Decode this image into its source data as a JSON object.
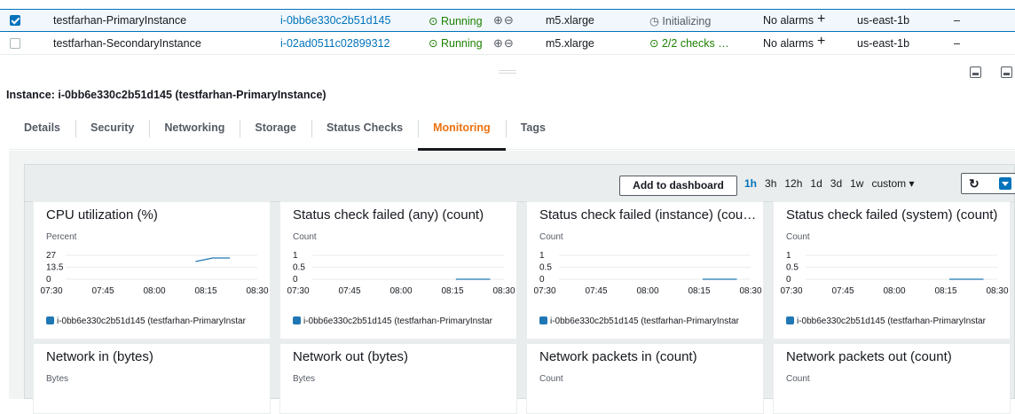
{
  "instances": [
    {
      "selected": true,
      "name": "testfarhan-PrimaryInstance",
      "id": "i-0bb6e330c2b51d145",
      "state": "Running",
      "type": "m5.xlarge",
      "status_check": "Initializing",
      "alarms": "No alarms",
      "az": "us-east-1b",
      "ip": "–"
    },
    {
      "selected": false,
      "name": "testfarhan-SecondaryInstance",
      "id": "i-02ad0511c02899312",
      "state": "Running",
      "type": "m5.xlarge",
      "status_check": "2/2 checks …",
      "alarms": "No alarms",
      "az": "us-east-1b",
      "ip": "–"
    }
  ],
  "details_header": "Instance: i-0bb6e330c2b51d145 (testfarhan-PrimaryInstance)",
  "tabs": [
    "Details",
    "Security",
    "Networking",
    "Storage",
    "Status Checks",
    "Monitoring",
    "Tags"
  ],
  "active_tab": "Monitoring",
  "toolbar": {
    "add_dashboard": "Add to dashboard",
    "ranges": [
      "1h",
      "3h",
      "12h",
      "1d",
      "3d",
      "1w",
      "custom ▾"
    ],
    "active_range": "1h"
  },
  "icons": {
    "running": "check-circle-icon",
    "initializing": "clock-icon",
    "zoom": "zoom-icons",
    "refresh": "refresh-icon",
    "dropdown": "caret-down-icon",
    "add_alarm": "plus-icon"
  },
  "colors": {
    "accent": "#0073bb",
    "active_tab": "#ec7211",
    "ok": "#1d8102",
    "series": "#1f77b4"
  },
  "legend_label": "i-0bb6e330c2b51d145 (testfarhan-PrimaryInstar",
  "chart_data": [
    {
      "type": "line",
      "title": "CPU utilization (%)",
      "ylabel": "Percent",
      "yticks": [
        "27",
        "13.5",
        "0"
      ],
      "ylim": [
        0,
        27
      ],
      "xticks": [
        "07:30",
        "07:45",
        "08:00",
        "08:15",
        "08:30"
      ],
      "series": [
        {
          "name": "i-0bb6e330c2b51d145 (testfarhan-PrimaryInstar",
          "x": [
            "08:12",
            "08:17",
            "08:22"
          ],
          "values": [
            20,
            24,
            24
          ]
        }
      ]
    },
    {
      "type": "line",
      "title": "Status check failed (any) (count)",
      "ylabel": "Count",
      "yticks": [
        "1",
        "0.5",
        "0"
      ],
      "ylim": [
        0,
        1
      ],
      "xticks": [
        "07:30",
        "07:45",
        "08:00",
        "08:15",
        "08:30"
      ],
      "series": [
        {
          "name": "i-0bb6e330c2b51d145 (testfarhan-PrimaryInstar",
          "x": [
            "08:16",
            "08:26"
          ],
          "values": [
            0,
            0
          ]
        }
      ]
    },
    {
      "type": "line",
      "title": "Status check failed (instance) (cou…",
      "ylabel": "Count",
      "yticks": [
        "1",
        "0.5",
        "0"
      ],
      "ylim": [
        0,
        1
      ],
      "xticks": [
        "07:30",
        "07:45",
        "08:00",
        "08:15",
        "08:30"
      ],
      "series": [
        {
          "name": "i-0bb6e330c2b51d145 (testfarhan-PrimaryInstar",
          "x": [
            "08:16",
            "08:26"
          ],
          "values": [
            0,
            0
          ]
        }
      ]
    },
    {
      "type": "line",
      "title": "Status check failed (system) (count)",
      "ylabel": "Count",
      "yticks": [
        "1",
        "0.5",
        "0"
      ],
      "ylim": [
        0,
        1
      ],
      "xticks": [
        "07:30",
        "07:45",
        "08:00",
        "08:15",
        "08:30"
      ],
      "series": [
        {
          "name": "i-0bb6e330c2b51d145 (testfarhan-PrimaryInstar",
          "x": [
            "08:16",
            "08:26"
          ],
          "values": [
            0,
            0
          ]
        }
      ]
    },
    {
      "type": "line",
      "title": "Network in (bytes)",
      "ylabel": "Bytes",
      "yticks": [],
      "xticks": [],
      "series": []
    },
    {
      "type": "line",
      "title": "Network out (bytes)",
      "ylabel": "Bytes",
      "yticks": [],
      "xticks": [],
      "series": []
    },
    {
      "type": "line",
      "title": "Network packets in (count)",
      "ylabel": "Count",
      "yticks": [],
      "xticks": [],
      "series": []
    },
    {
      "type": "line",
      "title": "Network packets out (count)",
      "ylabel": "Count",
      "yticks": [],
      "xticks": [],
      "series": []
    }
  ]
}
